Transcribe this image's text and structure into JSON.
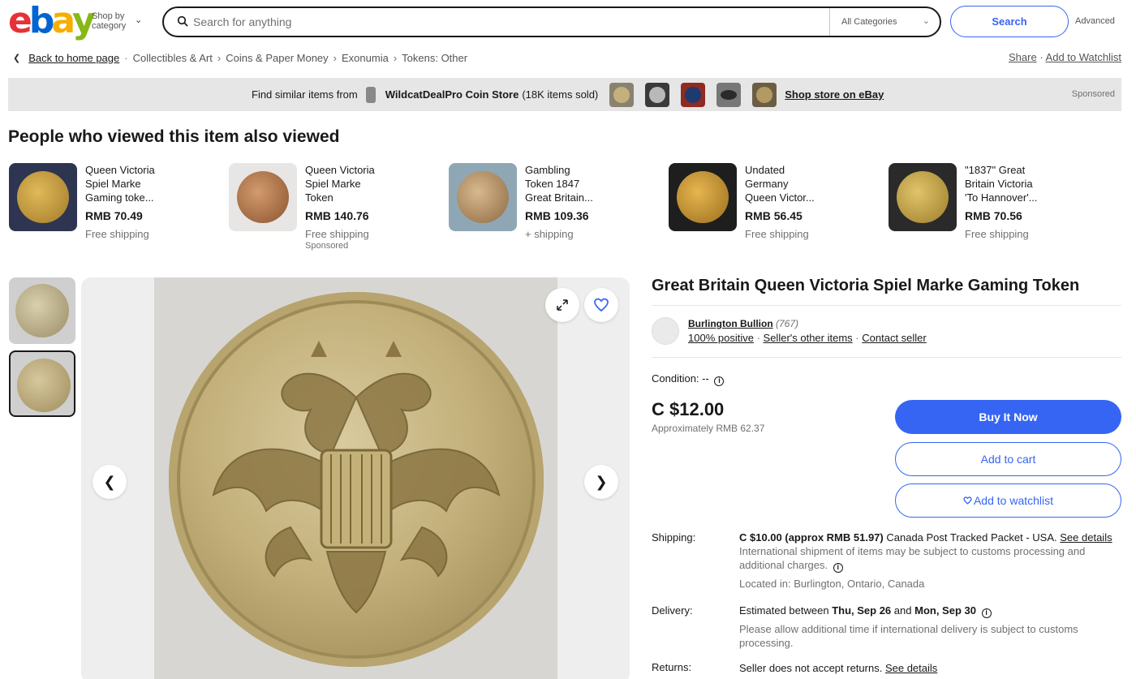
{
  "header": {
    "logo_letters": [
      "e",
      "b",
      "a",
      "y"
    ],
    "logo_colors": [
      "#e53238",
      "#0064d2",
      "#f5af02",
      "#86b817"
    ],
    "shop_by_line1": "Shop by",
    "shop_by_line2": "category",
    "search_placeholder": "Search for anything",
    "category_value": "All Categories",
    "search_button": "Search",
    "advanced": "Advanced"
  },
  "breadcrumb": {
    "back": "Back to home page",
    "items": [
      "Collectibles & Art",
      "Coins & Paper Money",
      "Exonumia",
      "Tokens: Other"
    ],
    "share": "Share",
    "add_watchlist": "Add to Watchlist"
  },
  "banner": {
    "find_text": "Find similar items from",
    "store_name": "WildcatDealPro Coin Store",
    "sold_text": "(18K items sold)",
    "shop_link": "Shop store on eBay",
    "sponsored": "Sponsored"
  },
  "also_viewed": {
    "title": "People who viewed this item also viewed",
    "items": [
      {
        "line1": "Queen Victoria",
        "line2": "Spiel Marke",
        "line3": "Gaming toke...",
        "price": "RMB 70.49",
        "shipping": "Free shipping",
        "sponsored": ""
      },
      {
        "line1": "Queen Victoria",
        "line2": "Spiel Marke",
        "line3": "Token",
        "price": "RMB 140.76",
        "shipping": "Free shipping",
        "sponsored": "Sponsored"
      },
      {
        "line1": "Gambling",
        "line2": "Token 1847",
        "line3": "Great Britain...",
        "price": "RMB 109.36",
        "shipping": "+ shipping",
        "sponsored": ""
      },
      {
        "line1": "Undated",
        "line2": "Germany",
        "line3": "Queen Victor...",
        "price": "RMB 56.45",
        "shipping": "Free shipping",
        "sponsored": ""
      },
      {
        "line1": "\"1837\" Great",
        "line2": "Britain Victoria",
        "line3": "'To Hannover'...",
        "price": "RMB 70.56",
        "shipping": "Free shipping",
        "sponsored": ""
      }
    ]
  },
  "item": {
    "title": "Great Britain Queen Victoria Spiel Marke Gaming Token",
    "seller_name": "Burlington Bullion",
    "seller_count": "(767)",
    "positive": "100% positive",
    "other_items": "Seller's other items",
    "contact": "Contact seller",
    "condition_label": "Condition:",
    "condition_value": "--",
    "price": "C $12.00",
    "approx_label": "Approximately",
    "approx_value": "RMB 62.37",
    "buy_now": "Buy It Now",
    "add_cart": "Add to cart",
    "add_watchlist": "Add to watchlist",
    "shipping_label": "Shipping:",
    "shipping_price": "C $10.00 (approx RMB 51.97)",
    "shipping_method": "Canada Post Tracked Packet - USA.",
    "see_details": "See details",
    "shipping_note": "International shipment of items may be subject to customs processing and additional charges.",
    "located": "Located in: Burlington, Ontario, Canada",
    "delivery_label": "Delivery:",
    "delivery_pre": "Estimated between",
    "delivery_from": "Thu, Sep 26",
    "delivery_and": "and",
    "delivery_to": "Mon, Sep 30",
    "delivery_note": "Please allow additional time if international delivery is subject to customs processing.",
    "returns_label": "Returns:",
    "returns_value": "Seller does not accept returns.",
    "returns_link": "See details"
  },
  "icons": {
    "expand": "expand-icon",
    "heart": "heart-icon",
    "prev": "chevron-left-icon",
    "next": "chevron-right-icon"
  }
}
